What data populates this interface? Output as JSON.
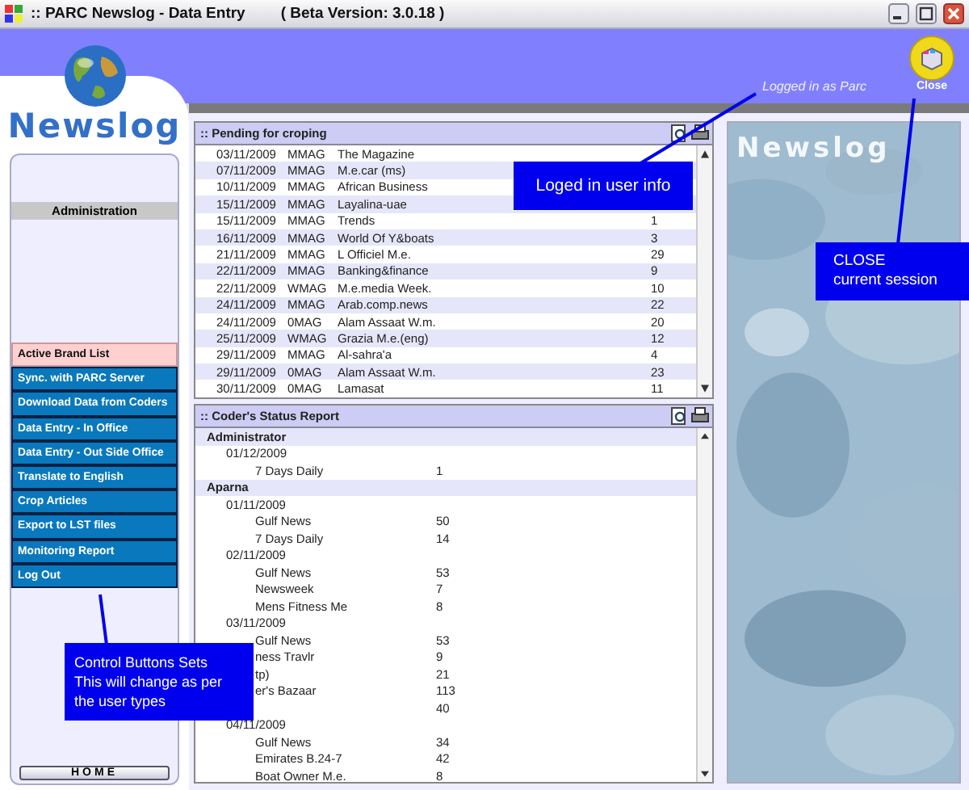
{
  "window": {
    "title": ":: PARC Newslog - Data Entry",
    "version": "( Beta Version: 3.0.18 )"
  },
  "header": {
    "logo": "Newslog",
    "user_info": "Logged in as Parc",
    "close_label": "Close"
  },
  "sidebar": {
    "section": "Administration",
    "buttons": [
      {
        "label": "Active Brand List",
        "selected": true
      },
      {
        "label": "Sync. with PARC Server",
        "selected": false
      },
      {
        "label": "Download Data from Coders",
        "selected": false
      },
      {
        "label": "Data Entry - In Office",
        "selected": false
      },
      {
        "label": "Data Entry - Out Side Office",
        "selected": false
      },
      {
        "label": "Translate to English",
        "selected": false
      },
      {
        "label": "Crop Articles",
        "selected": false
      },
      {
        "label": "Export to LST files",
        "selected": false
      },
      {
        "label": "Monitoring Report",
        "selected": false
      },
      {
        "label": "Log Out",
        "selected": false
      }
    ],
    "home": "HOME"
  },
  "pending": {
    "title": ":: Pending for croping",
    "rows": [
      {
        "date": "03/11/2009",
        "type": "MMAG",
        "title": "The Magazine"
      },
      {
        "date": "07/11/2009",
        "type": "MMAG",
        "title": "M.e.car (ms)"
      },
      {
        "date": "10/11/2009",
        "type": "MMAG",
        "title": "African Business"
      },
      {
        "date": "15/11/2009",
        "type": "MMAG",
        "title": "Layalina-uae"
      },
      {
        "date": "15/11/2009",
        "type": "MMAG",
        "title": "Trends",
        "count": "1"
      },
      {
        "date": "16/11/2009",
        "type": "MMAG",
        "title": "World Of Y&boats",
        "count": "3"
      },
      {
        "date": "21/11/2009",
        "type": "MMAG",
        "title": "L Officiel M.e.",
        "count": "29"
      },
      {
        "date": "22/11/2009",
        "type": "MMAG",
        "title": "Banking&finance",
        "count": "9"
      },
      {
        "date": "22/11/2009",
        "type": "WMAG",
        "title": "M.e.media Week.",
        "count": "10"
      },
      {
        "date": "24/11/2009",
        "type": "MMAG",
        "title": "Arab.comp.news",
        "count": "22"
      },
      {
        "date": "24/11/2009",
        "type": "0MAG",
        "title": "Alam Assaat W.m.",
        "count": "20"
      },
      {
        "date": "25/11/2009",
        "type": "WMAG",
        "title": "Grazia M.e.(eng)",
        "count": "12"
      },
      {
        "date": "29/11/2009",
        "type": "MMAG",
        "title": "Al-sahra'a",
        "count": "4"
      },
      {
        "date": "29/11/2009",
        "type": "0MAG",
        "title": "Alam Assaat W.m.",
        "count": "23"
      },
      {
        "date": "30/11/2009",
        "type": "0MAG",
        "title": "Lamasat",
        "count": "11"
      }
    ]
  },
  "report": {
    "title": ":: Coder's Status Report",
    "users": [
      {
        "name": "Administrator",
        "children": [
          {
            "date": "01/12/2009",
            "children": [
              {
                "name": "7 Days Daily",
                "count": "1"
              }
            ]
          }
        ]
      },
      {
        "name": "Aparna",
        "children": [
          {
            "date": "01/11/2009",
            "children": [
              {
                "name": "Gulf News",
                "count": "50"
              },
              {
                "name": "7 Days Daily",
                "count": "14"
              }
            ]
          },
          {
            "date": "02/11/2009",
            "children": [
              {
                "name": "Gulf News",
                "count": "53"
              },
              {
                "name": "Newsweek",
                "count": "7"
              },
              {
                "name": "Mens Fitness Me",
                "count": "8"
              }
            ]
          },
          {
            "date": "03/11/2009",
            "children": [
              {
                "name": "Gulf News",
                "count": "53"
              },
              {
                "name": "ness Travlr",
                "count": "9"
              },
              {
                "name": "tp)",
                "count": "21"
              },
              {
                "name": "er's Bazaar",
                "count": "113"
              },
              {
                "count": "40"
              }
            ]
          },
          {
            "date": "04/11/2009",
            "children": [
              {
                "name": "Gulf News",
                "count": "34"
              },
              {
                "name": "Emirates B.24-7",
                "count": "42"
              },
              {
                "name": "Boat Owner M.e.",
                "count": "8"
              }
            ]
          }
        ]
      }
    ]
  },
  "preview": {
    "logo": "Newslog"
  },
  "annotations": [
    {
      "lines": [
        "Loged in user info"
      ]
    },
    {
      "lines": [
        "CLOSE",
        "current session"
      ]
    },
    {
      "lines": [
        "Control Buttons Sets",
        "This will change as per",
        "the user types"
      ]
    }
  ]
}
